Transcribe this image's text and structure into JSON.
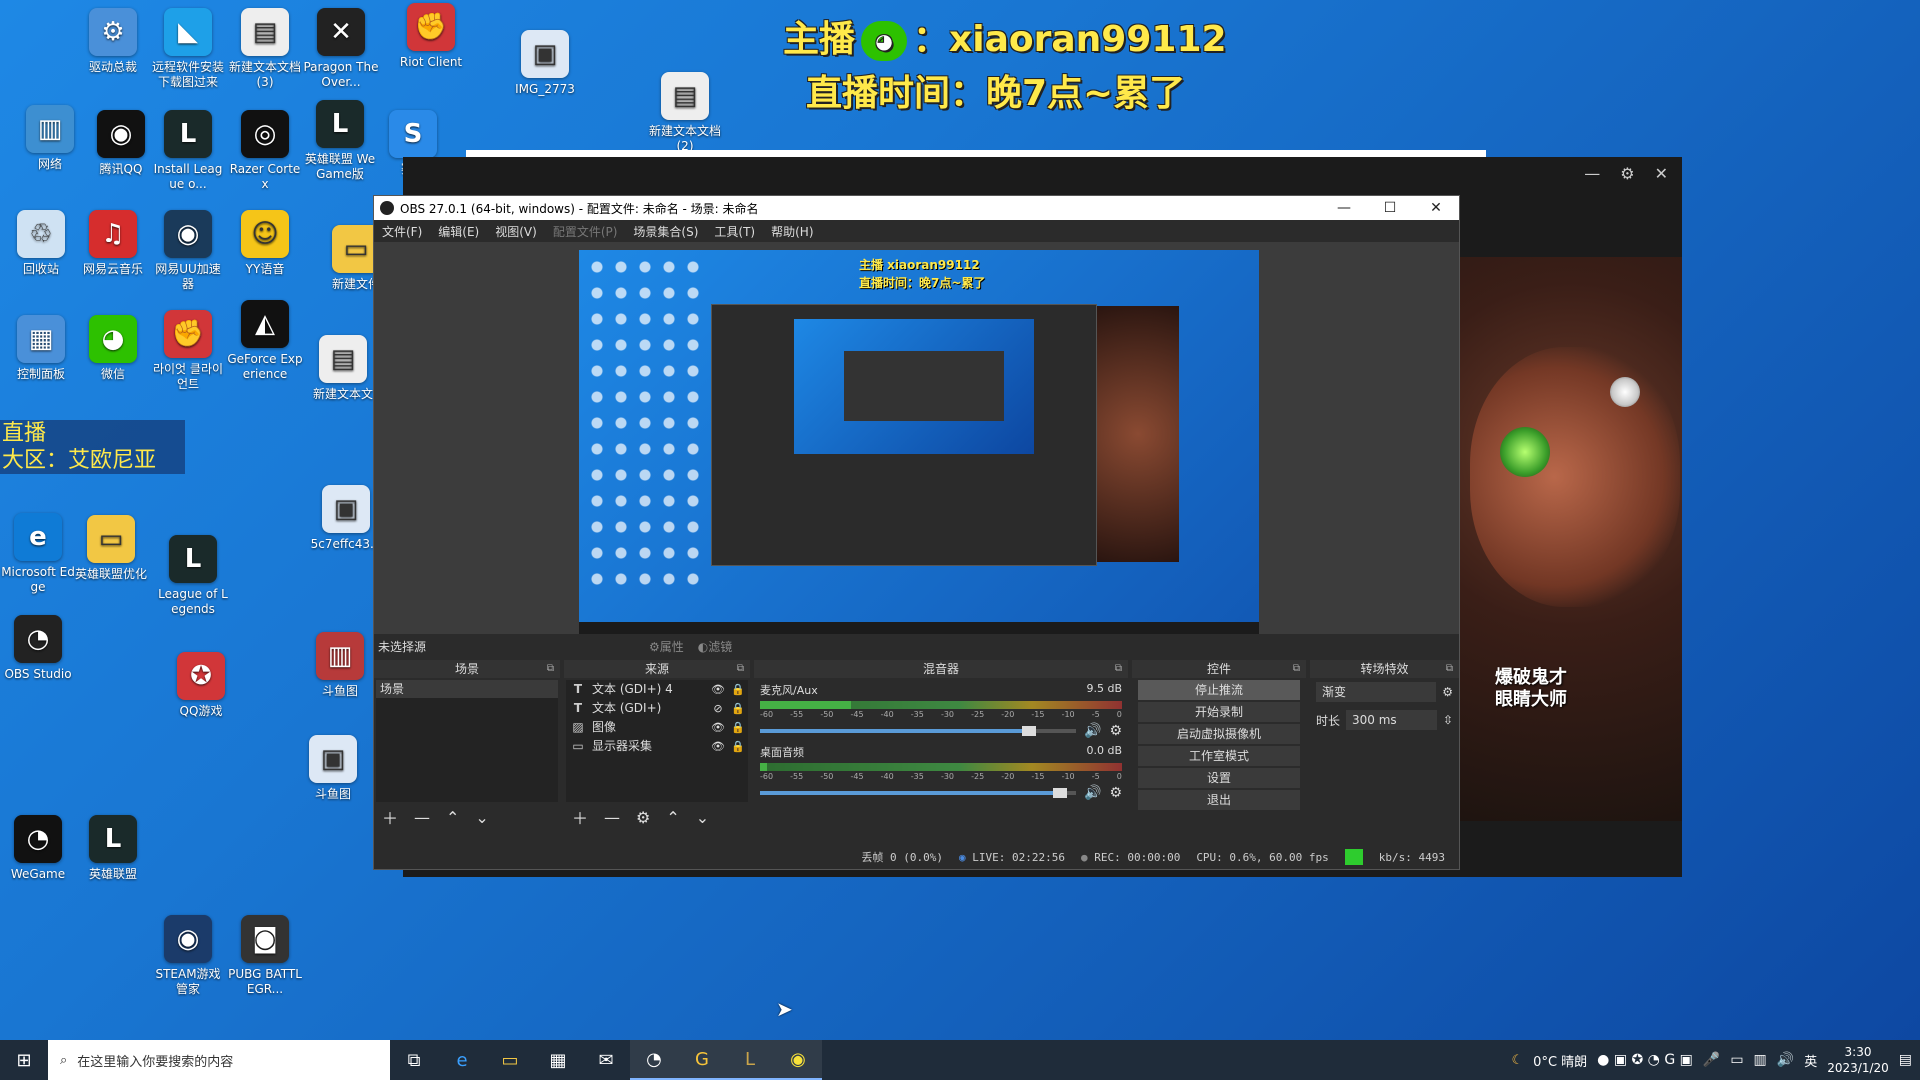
{
  "overlay": {
    "line1_prefix": "主播",
    "line1_sep": "：",
    "line1_id": "xiaoran99112",
    "line2": "直播时间：晚7点~累了",
    "banner_line1": "直播",
    "banner_line2": "大区：艾欧尼亚"
  },
  "desktop_icons": [
    {
      "id": "qudong",
      "label": "驱动总裁",
      "color": "#4a90d9",
      "glyph": "⚙"
    },
    {
      "id": "yuancheng",
      "label": "远程软件安装下载图过来",
      "color": "#1ea0e8",
      "glyph": "◣"
    },
    {
      "id": "newtxt3",
      "label": "新建文本文档 (3)",
      "color": "#eeeeee",
      "glyph": "▤"
    },
    {
      "id": "paragon",
      "label": "Paragon The Over...",
      "color": "#222222",
      "glyph": "✕"
    },
    {
      "id": "riot",
      "label": "Riot Client",
      "color": "#d13639",
      "glyph": "✊"
    },
    {
      "id": "img2773",
      "label": "IMG_2773",
      "color": "#dde8f5",
      "glyph": "▣"
    },
    {
      "id": "newtxt2",
      "label": "新建文本文档 (2)",
      "color": "#eeeeee",
      "glyph": "▤"
    },
    {
      "id": "network",
      "label": "网络",
      "color": "#3d8fd1",
      "glyph": "▥"
    },
    {
      "id": "qq",
      "label": "腾讯QQ",
      "color": "#111111",
      "glyph": "◉"
    },
    {
      "id": "installlol",
      "label": "Install League o...",
      "color": "#1a2a2a",
      "glyph": "L"
    },
    {
      "id": "razer",
      "label": "Razer Cortex",
      "color": "#111111",
      "glyph": "◎"
    },
    {
      "id": "lolwegame",
      "label": "英雄联盟 WeGame版",
      "color": "#1a2a2a",
      "glyph": "L"
    },
    {
      "id": "sai",
      "label": "赛博",
      "color": "#2a8ae8",
      "glyph": "S"
    },
    {
      "id": "recycle",
      "label": "回收站",
      "color": "#cfe2f3",
      "glyph": "♲"
    },
    {
      "id": "neteasemusic",
      "label": "网易云音乐",
      "color": "#d62d2d",
      "glyph": "♫"
    },
    {
      "id": "uu",
      "label": "网易UU加速器",
      "color": "#1a3a5a",
      "glyph": "◉"
    },
    {
      "id": "yy",
      "label": "YY语音",
      "color": "#f5c518",
      "glyph": "☺"
    },
    {
      "id": "newfolder",
      "label": "新建文件",
      "color": "#f2c744",
      "glyph": "▭"
    },
    {
      "id": "controlpanel",
      "label": "控制面板",
      "color": "#4a90d9",
      "glyph": "▦"
    },
    {
      "id": "wechat",
      "label": "微信",
      "color": "#2dc100",
      "glyph": "◕"
    },
    {
      "id": "riotkr",
      "label": "라이엇 클라이언트",
      "color": "#d13639",
      "glyph": "✊"
    },
    {
      "id": "geforce",
      "label": "GeForce Experience",
      "color": "#111111",
      "glyph": "◭"
    },
    {
      "id": "newtxt",
      "label": "新建文本文",
      "color": "#eeeeee",
      "glyph": "▤"
    },
    {
      "id": "edge",
      "label": "Microsoft Edge",
      "color": "#0f7bd6",
      "glyph": "e"
    },
    {
      "id": "loloptim",
      "label": "英雄联盟优化",
      "color": "#f2c744",
      "glyph": "▭"
    },
    {
      "id": "lol",
      "label": "League of Legends",
      "color": "#1a2a2a",
      "glyph": "L"
    },
    {
      "id": "img5c7",
      "label": "5c7effc43...",
      "color": "#dde8f5",
      "glyph": "▣"
    },
    {
      "id": "obs",
      "label": "OBS Studio",
      "color": "#222222",
      "glyph": "◔"
    },
    {
      "id": "qqgame",
      "label": "QQ游戏",
      "color": "#d13639",
      "glyph": "✪"
    },
    {
      "id": "douyu1",
      "label": "斗鱼图",
      "color": "#b73a3a",
      "glyph": "▥"
    },
    {
      "id": "douyu2",
      "label": "斗鱼图",
      "color": "#dde8f5",
      "glyph": "▣"
    },
    {
      "id": "wegame",
      "label": "WeGame",
      "color": "#111111",
      "glyph": "◔"
    },
    {
      "id": "lol2",
      "label": "英雄联盟",
      "color": "#1a2a2a",
      "glyph": "L"
    },
    {
      "id": "steam",
      "label": "STEAM游戏管家",
      "color": "#1b3b6a",
      "glyph": "◉"
    },
    {
      "id": "pubg",
      "label": "PUBG BATTLEGR...",
      "color": "#333333",
      "glyph": "◙"
    }
  ],
  "bg_window": {
    "min": "—",
    "settings": "⚙",
    "close": "✕",
    "caption_line1": "爆破鬼才",
    "caption_line2": "眼睛大师"
  },
  "obs": {
    "title": "OBS 27.0.1 (64-bit, windows) - 配置文件: 未命名 - 场景: 未命名",
    "win_min": "—",
    "win_max": "☐",
    "win_close": "✕",
    "menu": [
      "文件(F)",
      "编辑(E)",
      "视图(V)",
      "配置文件(P)",
      "场景集合(S)",
      "工具(T)",
      "帮助(H)"
    ],
    "preview_text1": "主播 xiaoran99112",
    "preview_text2": "直播时间：晚7点~累了",
    "no_source": "未选择源",
    "props_btn": "属性",
    "filters_btn": "滤镜",
    "docks": {
      "scenes": "场景",
      "sources": "来源",
      "mixer": "混音器",
      "controls": "控件",
      "transitions": "转场特效"
    },
    "scene_list": [
      "场景"
    ],
    "sources": [
      {
        "icon": "T",
        "name": "文本 (GDI+) 4",
        "eye": "👁",
        "lock": "🔒"
      },
      {
        "icon": "T",
        "name": "文本 (GDI+)",
        "eye": "⊘",
        "lock": "🔒"
      },
      {
        "icon": "▨",
        "name": "图像",
        "eye": "👁",
        "lock": "🔒"
      },
      {
        "icon": "▭",
        "name": "显示器采集",
        "eye": "👁",
        "lock": "🔒"
      }
    ],
    "mixer": [
      {
        "name": "麦克风/Aux",
        "db": "9.5 dB",
        "level": 0.25,
        "fader": 0.85
      },
      {
        "name": "桌面音频",
        "db": "0.0 dB",
        "level": 0.02,
        "fader": 0.95
      }
    ],
    "mixer_ticks": [
      "-60",
      "-55",
      "-50",
      "-45",
      "-40",
      "-35",
      "-30",
      "-25",
      "-20",
      "-15",
      "-10",
      "-5",
      "0"
    ],
    "controls": [
      "停止推流",
      "开始录制",
      "启动虚拟摄像机",
      "工作室模式",
      "设置",
      "退出"
    ],
    "transition_name": "渐变",
    "duration_label": "时长",
    "duration_value": "300 ms",
    "status": {
      "dropped": "丢帧 0 (0.0%)",
      "live": "LIVE: 02:22:56",
      "rec": "REC: 00:00:00",
      "cpu": "CPU: 0.6%, 60.00 fps",
      "kbs": "kb/s: 4493"
    }
  },
  "taskbar": {
    "search_placeholder": "在这里输入你要搜索的内容",
    "weather": "0°C 晴朗",
    "ime": "英",
    "time": "3:30",
    "date": "2023/1/20"
  }
}
